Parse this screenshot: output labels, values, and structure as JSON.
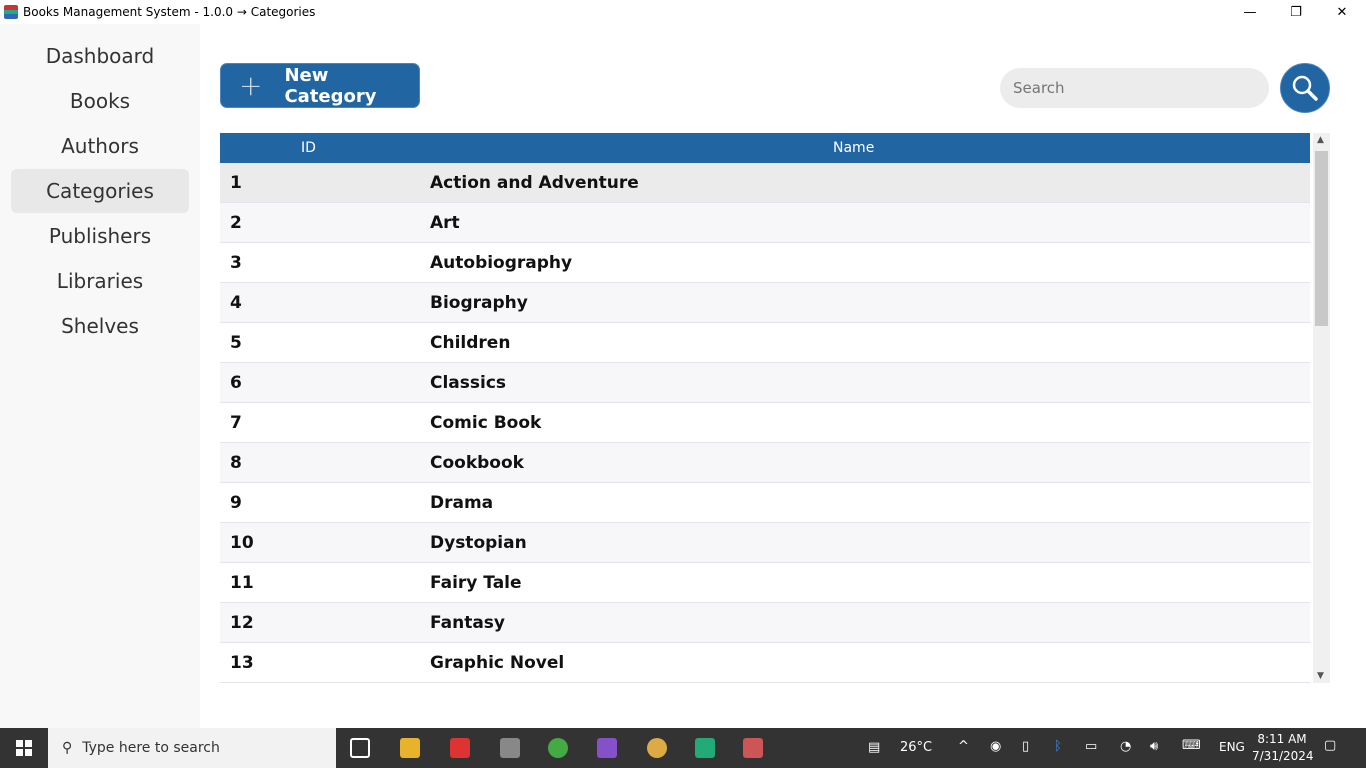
{
  "window": {
    "title": "Books Management System - 1.0.0 → Categories",
    "minimize": "—",
    "maximize": "❐",
    "close": "✕"
  },
  "sidebar": {
    "items": [
      {
        "label": "Dashboard"
      },
      {
        "label": "Books"
      },
      {
        "label": "Authors"
      },
      {
        "label": "Categories",
        "active": true
      },
      {
        "label": "Publishers"
      },
      {
        "label": "Libraries"
      },
      {
        "label": "Shelves"
      }
    ]
  },
  "toolbar": {
    "new_label": "New Category",
    "search_placeholder": "Search"
  },
  "table": {
    "headers": {
      "id": "ID",
      "name": "Name"
    },
    "rows": [
      {
        "id": "1",
        "name": "Action and Adventure"
      },
      {
        "id": "2",
        "name": "Art"
      },
      {
        "id": "3",
        "name": "Autobiography"
      },
      {
        "id": "4",
        "name": "Biography"
      },
      {
        "id": "5",
        "name": "Children"
      },
      {
        "id": "6",
        "name": "Classics"
      },
      {
        "id": "7",
        "name": "Comic Book"
      },
      {
        "id": "8",
        "name": "Cookbook"
      },
      {
        "id": "9",
        "name": "Drama"
      },
      {
        "id": "10",
        "name": "Dystopian"
      },
      {
        "id": "11",
        "name": "Fairy Tale"
      },
      {
        "id": "12",
        "name": "Fantasy"
      },
      {
        "id": "13",
        "name": "Graphic Novel"
      }
    ]
  },
  "taskbar": {
    "search_placeholder": "Type here to search",
    "weather": "26°C",
    "language": "ENG",
    "time": "8:11 AM",
    "date": "7/31/2024"
  }
}
